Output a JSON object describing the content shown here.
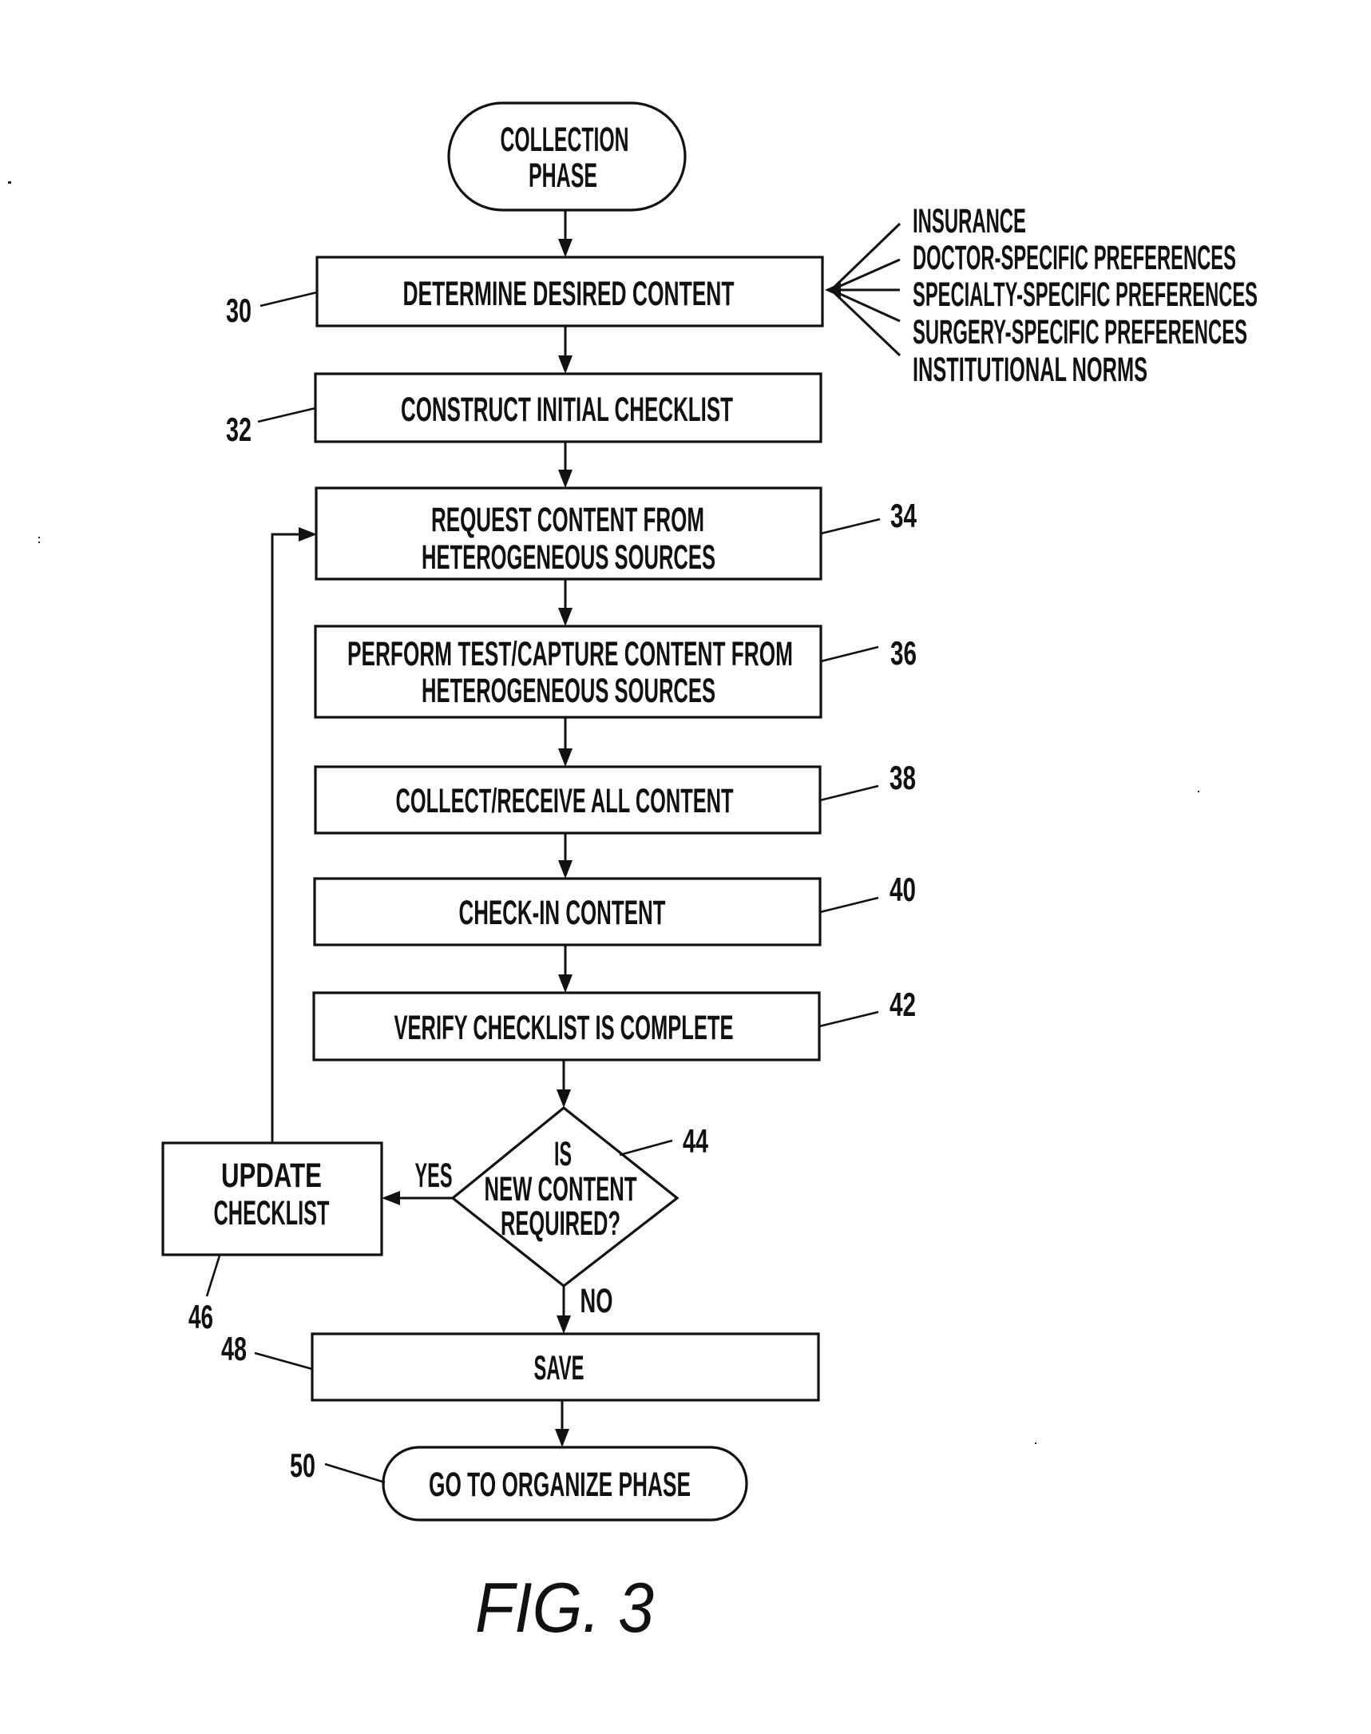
{
  "figure": {
    "caption": "FIG. 3",
    "colors": {
      "ink": "#111111",
      "paper": "#ffffff"
    }
  },
  "nodes": {
    "start": {
      "type": "terminator",
      "lines": [
        "COLLECTION",
        "PHASE"
      ]
    },
    "determine": {
      "ref": "30",
      "type": "process",
      "lines": [
        "DETERMINE DESIRED CONTENT"
      ]
    },
    "construct": {
      "ref": "32",
      "type": "process",
      "lines": [
        "CONSTRUCT INITIAL CHECKLIST"
      ]
    },
    "request": {
      "ref": "34",
      "type": "process",
      "lines": [
        "REQUEST CONTENT FROM",
        "HETEROGENEOUS SOURCES"
      ]
    },
    "perform": {
      "ref": "36",
      "type": "process",
      "lines": [
        "PERFORM TEST/CAPTURE CONTENT FROM",
        "HETEROGENEOUS SOURCES"
      ]
    },
    "collect": {
      "ref": "38",
      "type": "process",
      "lines": [
        "COLLECT/RECEIVE ALL CONTENT"
      ]
    },
    "checkin": {
      "ref": "40",
      "type": "process",
      "lines": [
        "CHECK-IN CONTENT"
      ]
    },
    "verify": {
      "ref": "42",
      "type": "process",
      "lines": [
        "VERIFY CHECKLIST IS COMPLETE"
      ]
    },
    "decision": {
      "ref": "44",
      "type": "decision",
      "lines": [
        "IS",
        "NEW CONTENT",
        "REQUIRED?"
      ]
    },
    "update": {
      "ref": "46",
      "type": "process",
      "lines": [
        "UPDATE",
        "CHECKLIST"
      ]
    },
    "save": {
      "ref": "48",
      "type": "process",
      "lines": [
        "SAVE"
      ]
    },
    "end": {
      "ref": "50",
      "type": "terminator",
      "lines": [
        "GO TO ORGANIZE PHASE"
      ]
    }
  },
  "inputs": {
    "target": "determine",
    "items": [
      "INSURANCE",
      "DOCTOR-SPECIFIC PREFERENCES",
      "SPECIALTY-SPECIFIC PREFERENCES",
      "SURGERY-SPECIFIC PREFERENCES",
      "INSTITUTIONAL NORMS"
    ]
  },
  "edges": [
    {
      "from": "start",
      "to": "determine"
    },
    {
      "from": "determine",
      "to": "construct"
    },
    {
      "from": "construct",
      "to": "request"
    },
    {
      "from": "request",
      "to": "perform"
    },
    {
      "from": "perform",
      "to": "collect"
    },
    {
      "from": "collect",
      "to": "checkin"
    },
    {
      "from": "checkin",
      "to": "verify"
    },
    {
      "from": "verify",
      "to": "decision"
    },
    {
      "from": "decision",
      "to": "update",
      "label": "YES"
    },
    {
      "from": "decision",
      "to": "save",
      "label": "NO"
    },
    {
      "from": "update",
      "to": "request"
    },
    {
      "from": "save",
      "to": "end"
    }
  ]
}
